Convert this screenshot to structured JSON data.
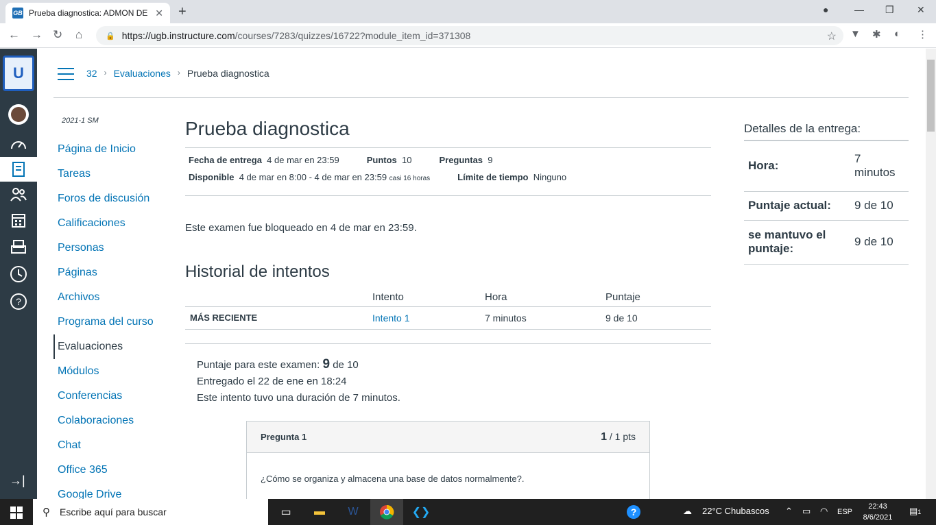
{
  "browser": {
    "tab_title": "Prueba diagnostica: ADMON DE",
    "tab_favicon": "GB",
    "url_host": "https://ugb.instructure.com",
    "url_path": "/courses/7283/quizzes/16722?module_item_id=371308"
  },
  "breadcrumb": {
    "course": "32",
    "section": "Evaluaciones",
    "current": "Prueba diagnostica"
  },
  "course_nav": {
    "term": "2021-1 SM",
    "items": [
      "Página de Inicio",
      "Tareas",
      "Foros de discusión",
      "Calificaciones",
      "Personas",
      "Páginas",
      "Archivos",
      "Programa del curso",
      "Evaluaciones",
      "Módulos",
      "Conferencias",
      "Colaboraciones",
      "Chat",
      "Office 365",
      "Google Drive"
    ],
    "active": "Evaluaciones"
  },
  "quiz": {
    "title": "Prueba diagnostica",
    "due_label": "Fecha de entrega",
    "due_value": "4 de mar en 23:59",
    "points_label": "Puntos",
    "points_value": "10",
    "questions_label": "Preguntas",
    "questions_value": "9",
    "available_label": "Disponible",
    "available_value": "4 de mar en 8:00 - 4 de mar en 23:59",
    "available_note": "casi 16 horas",
    "time_limit_label": "Límite de tiempo",
    "time_limit_value": "Ninguno",
    "locked_msg": "Este examen fue bloqueado en 4 de mar en 23:59.",
    "history_title": "Historial de intentos",
    "history_headers": [
      "",
      "Intento",
      "Hora",
      "Puntaje"
    ],
    "history_row": {
      "label": "MÁS RECIENTE",
      "attempt": "Intento 1",
      "time": "7 minutos",
      "score": "9 de 10"
    },
    "score_prefix": "Puntaje para este examen:",
    "score_value": "9",
    "score_suffix": "de 10",
    "submitted": "Entregado el 22 de ene en 18:24",
    "duration": "Este intento tuvo una duración de 7 minutos.",
    "question": {
      "label": "Pregunta 1",
      "earned": "1",
      "total": "/ 1 pts",
      "text": "¿Cómo se organiza y almacena una base de datos normalmente?."
    }
  },
  "sidebar": {
    "title": "Detalles de la entrega:",
    "rows": [
      {
        "k": "Hora:",
        "v": "7 minutos"
      },
      {
        "k": "Puntaje actual:",
        "v": "9 de 10"
      },
      {
        "k": "se mantuvo el puntaje:",
        "v": "9 de 10"
      }
    ]
  },
  "taskbar": {
    "search_placeholder": "Escribe aquí para buscar",
    "weather": "22°C  Chubascos",
    "lang": "ESP",
    "time": "22:43",
    "date": "8/6/2021",
    "notif_count": "1"
  }
}
